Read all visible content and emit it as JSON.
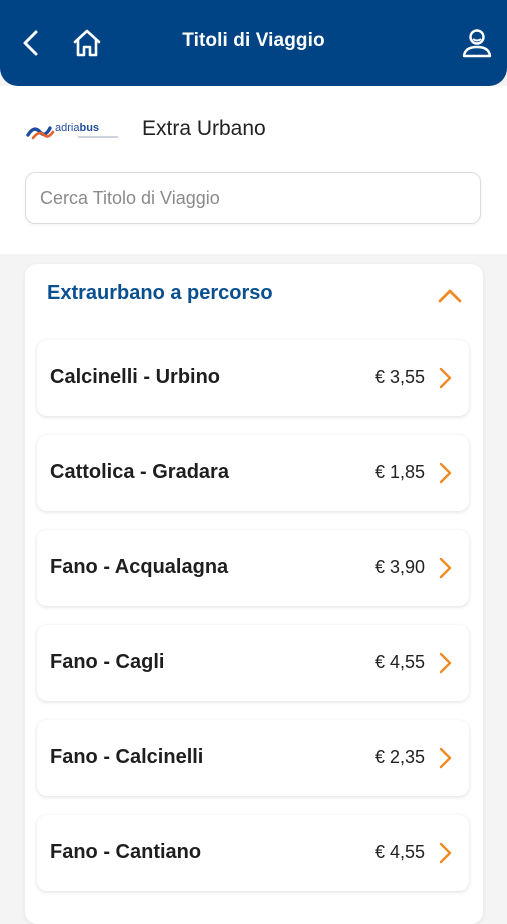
{
  "header": {
    "title": "Titoli di Viaggio",
    "back_icon": "chevron-left-icon",
    "home_icon": "home-icon",
    "profile_icon": "user-icon"
  },
  "operator": {
    "logo_text": "adriabus",
    "zone": "Extra Urbano"
  },
  "search": {
    "placeholder": "Cerca Titolo di Viaggio",
    "value": ""
  },
  "section": {
    "title": "Extraurbano a percorso",
    "expanded": true,
    "items": [
      {
        "name": "Calcinelli - Urbino",
        "price": "€ 3,55"
      },
      {
        "name": "Cattolica - Gradara",
        "price": "€ 1,85"
      },
      {
        "name": "Fano - Acqualagna",
        "price": "€ 3,90"
      },
      {
        "name": "Fano - Cagli",
        "price": "€ 4,55"
      },
      {
        "name": "Fano - Calcinelli",
        "price": "€ 2,35"
      },
      {
        "name": "Fano - Cantiano",
        "price": "€ 4,55"
      }
    ]
  },
  "colors": {
    "header_bg": "#004485",
    "accent_orange": "#f08a24",
    "section_title": "#0a4f8f"
  }
}
